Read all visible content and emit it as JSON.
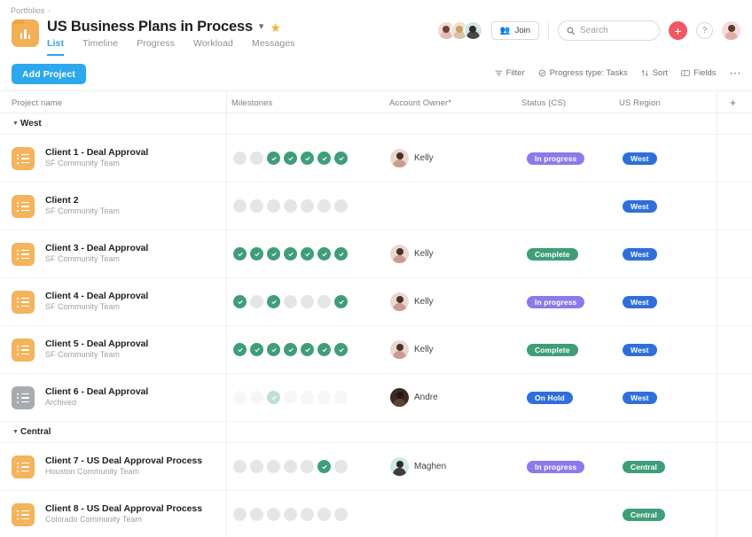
{
  "breadcrumb": {
    "label": "Portfolios",
    "separator": "›"
  },
  "header": {
    "title": "US Business Plans in Process",
    "title_chevron_icon": "chevron-down-icon",
    "star_icon": "star-icon",
    "portfolio_icon": "portfolio-folder-icon",
    "tabs": [
      {
        "label": "List",
        "active": true
      },
      {
        "label": "Timeline",
        "active": false
      },
      {
        "label": "Progress",
        "active": false
      },
      {
        "label": "Workload",
        "active": false
      },
      {
        "label": "Messages",
        "active": false
      }
    ],
    "join_label": "Join",
    "join_icon": "people-icon",
    "search": {
      "placeholder": "Search",
      "icon": "search-icon"
    },
    "plus_button": {
      "label": "+",
      "icon": "plus-icon",
      "color": "#f25563"
    },
    "help_button": {
      "label": "?",
      "icon": "question-mark-icon"
    },
    "member_avatars": [
      "avatar-member-1",
      "avatar-member-2",
      "avatar-member-3"
    ],
    "account_avatar": "avatar-current-user"
  },
  "toolbar": {
    "add_project_label": "Add Project",
    "filter_label": "Filter",
    "filter_icon": "filter-icon",
    "progress_type_label": "Progress type: Tasks",
    "progress_type_icon": "progress-circle-icon",
    "sort_label": "Sort",
    "sort_icon": "sort-arrows-icon",
    "fields_label": "Fields",
    "fields_icon": "fields-icon",
    "more_label": "⋯",
    "more_icon": "ellipsis-icon"
  },
  "table": {
    "columns": {
      "project_name": "Project name",
      "milestones": "Milestones",
      "account_owner": "Account Owner*",
      "status": "Status (CS)",
      "region": "US Region",
      "add_column": "+"
    },
    "groups": [
      {
        "name": "West",
        "caret_icon": "caret-down-icon",
        "rows": [
          {
            "name": "Client 1 - Deal Approval",
            "team": "SF Community Team",
            "archived": false,
            "milestones": [
              false,
              false,
              true,
              true,
              true,
              true,
              true
            ],
            "owner": "Kelly",
            "owner_avatar": "avatar-kelly",
            "status": "In progress",
            "status_color": "purple",
            "region": "West",
            "region_color": "blue"
          },
          {
            "name": "Client 2",
            "team": "SF Community Team",
            "archived": false,
            "milestones": [
              false,
              false,
              false,
              false,
              false,
              false,
              false
            ],
            "owner": "",
            "owner_avatar": "",
            "status": "",
            "status_color": "",
            "region": "West",
            "region_color": "blue"
          },
          {
            "name": "Client 3 - Deal Approval",
            "team": "SF Community Team",
            "archived": false,
            "milestones": [
              true,
              true,
              true,
              true,
              true,
              true,
              true
            ],
            "owner": "Kelly",
            "owner_avatar": "avatar-kelly",
            "status": "Complete",
            "status_color": "green",
            "region": "West",
            "region_color": "blue"
          },
          {
            "name": "Client 4 - Deal Approval",
            "team": "SF Community Team",
            "archived": false,
            "milestones": [
              true,
              false,
              true,
              false,
              false,
              false,
              true
            ],
            "owner": "Kelly",
            "owner_avatar": "avatar-kelly",
            "status": "In progress",
            "status_color": "purple",
            "region": "West",
            "region_color": "blue"
          },
          {
            "name": "Client 5 - Deal Approval",
            "team": "SF Community Team",
            "archived": false,
            "milestones": [
              true,
              true,
              true,
              true,
              true,
              true,
              true
            ],
            "owner": "Kelly",
            "owner_avatar": "avatar-kelly",
            "status": "Complete",
            "status_color": "green",
            "region": "West",
            "region_color": "blue"
          },
          {
            "name": "Client 6 - Deal Approval",
            "team": "Archived",
            "archived": true,
            "milestones": [
              false,
              false,
              true,
              false,
              false,
              false,
              false
            ],
            "owner": "Andre",
            "owner_avatar": "avatar-andre",
            "status": "On Hold",
            "status_color": "blue",
            "region": "West",
            "region_color": "blue"
          }
        ]
      },
      {
        "name": "Central",
        "caret_icon": "caret-down-icon",
        "rows": [
          {
            "name": "Client 7 - US Deal Approval Process",
            "team": "Houston Community Team",
            "archived": false,
            "milestones": [
              false,
              false,
              false,
              false,
              false,
              true,
              false
            ],
            "owner": "Maghen",
            "owner_avatar": "avatar-maghen",
            "status": "In progress",
            "status_color": "purple",
            "region": "Central",
            "region_color": "green"
          },
          {
            "name": "Client 8 - US Deal Approval Process",
            "team": "Colorado Community Team",
            "archived": false,
            "milestones": [
              false,
              false,
              false,
              false,
              false,
              false,
              false
            ],
            "owner": "",
            "owner_avatar": "",
            "status": "",
            "status_color": "",
            "region": "Central",
            "region_color": "green"
          }
        ]
      }
    ]
  },
  "colors": {
    "accent_blue": "#2ca8ec",
    "milestone_done": "#3f9e78",
    "milestone_todo": "#e4e5e7",
    "project_icon": "#f3b45d",
    "archived_icon": "#a8abb0",
    "badge_purple": "#8a7bea",
    "badge_green": "#3f9e78",
    "badge_blue": "#2f6fdd",
    "plus_red": "#f25563"
  }
}
